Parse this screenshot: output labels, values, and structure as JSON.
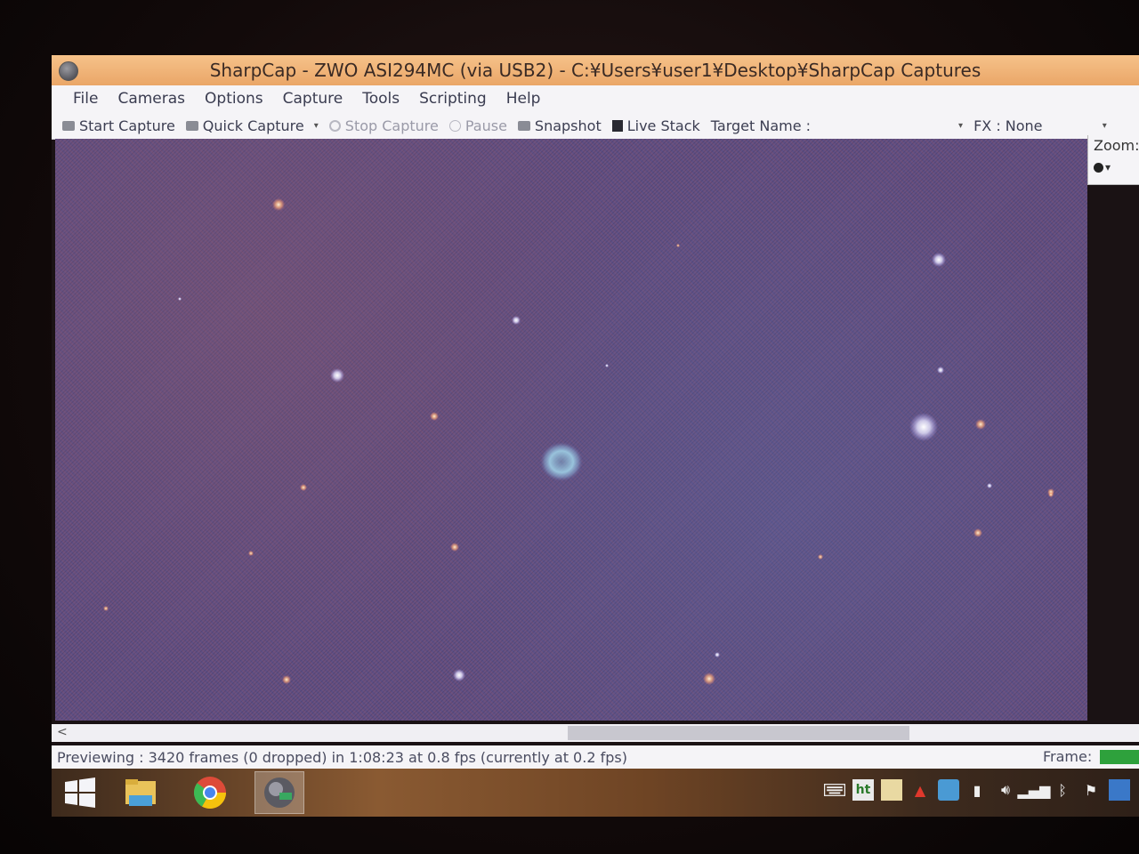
{
  "window": {
    "title": "SharpCap - ZWO ASI294MC (via USB2) - C:¥Users¥user1¥Desktop¥SharpCap Captures"
  },
  "menu": [
    "File",
    "Cameras",
    "Options",
    "Capture",
    "Tools",
    "Scripting",
    "Help"
  ],
  "toolbar": {
    "start_capture": "Start Capture",
    "quick_capture": "Quick Capture",
    "stop_capture": "Stop Capture",
    "pause": "Pause",
    "snapshot": "Snapshot",
    "live_stack": "Live Stack",
    "target_name_label": "Target Name :",
    "target_name_value": "",
    "fx_label": "FX :",
    "fx_value": "None"
  },
  "zoom": {
    "label": "Zoom:"
  },
  "status": {
    "text": "Previewing : 3420 frames (0 dropped) in 1:08:23 at 0.8 fps  (currently at 0.2 fps)",
    "frame_label": "Frame:"
  },
  "taskbar": {
    "apps": [
      "windows-start-icon",
      "file-explorer-icon",
      "chrome-icon",
      "sharpcap-icon"
    ],
    "tray": [
      "keyboard-icon",
      "ht-icon",
      "notes-icon",
      "acrobat-icon",
      "network-app-icon",
      "battery-icon",
      "volume-icon",
      "signal-icon",
      "bluetooth-icon",
      "flag-icon",
      "display-icon"
    ]
  },
  "colors": {
    "titlebar": "#eea96a",
    "sky": "#5b4a78",
    "frame_indicator": "#2ea13c"
  }
}
